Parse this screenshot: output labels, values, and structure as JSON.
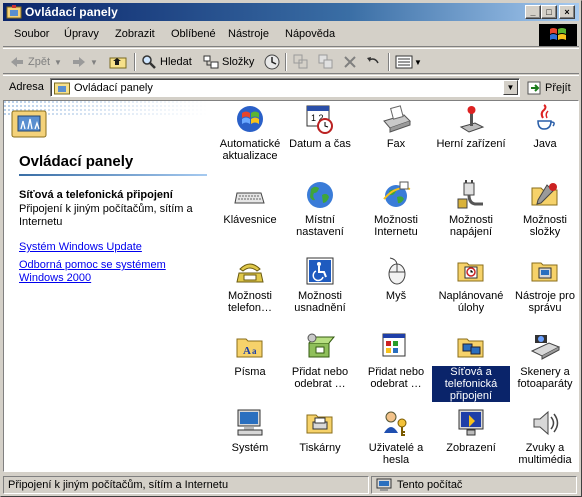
{
  "window": {
    "title": "Ovládací panely"
  },
  "menu": [
    "Soubor",
    "Úpravy",
    "Zobrazit",
    "Oblíbené",
    "Nástroje",
    "Nápověda"
  ],
  "toolbar": {
    "back": "Zpět",
    "search": "Hledat",
    "folders": "Složky"
  },
  "address": {
    "label": "Adresa",
    "value": "Ovládací panely",
    "go": "Přejít"
  },
  "left_pane": {
    "title": "Ovládací panely",
    "selected_name": "Síťová a telefonická připojení",
    "selected_desc": "Připojení k jiným počítačům, sítím a Internetu",
    "links": [
      "Systém Windows Update",
      "Odborná pomoc se systémem Windows 2000"
    ]
  },
  "items": [
    {
      "label": "Automatické aktualizace",
      "icon": "windows-update-icon"
    },
    {
      "label": "Datum a čas",
      "icon": "calendar-clock-icon"
    },
    {
      "label": "Fax",
      "icon": "fax-icon"
    },
    {
      "label": "Herní zařízení",
      "icon": "joystick-icon"
    },
    {
      "label": "Java",
      "icon": "java-cup-icon"
    },
    {
      "label": "Klávesnice",
      "icon": "keyboard-icon"
    },
    {
      "label": "Místní nastavení",
      "icon": "globe-icon"
    },
    {
      "label": "Možnosti Internetu",
      "icon": "internet-globe-icon"
    },
    {
      "label": "Možnosti napájení",
      "icon": "power-plug-icon"
    },
    {
      "label": "Možnosti složky",
      "icon": "folder-options-icon"
    },
    {
      "label": "Možnosti telefon…",
      "icon": "telephone-icon"
    },
    {
      "label": "Možnosti usnadnění",
      "icon": "accessibility-icon"
    },
    {
      "label": "Myš",
      "icon": "mouse-icon"
    },
    {
      "label": "Naplánované úlohy",
      "icon": "scheduled-tasks-icon"
    },
    {
      "label": "Nástroje pro správu",
      "icon": "admin-tools-icon"
    },
    {
      "label": "Písma",
      "icon": "fonts-folder-icon"
    },
    {
      "label": "Přidat nebo odebrat …",
      "icon": "add-remove-programs-icon"
    },
    {
      "label": "Přidat nebo odebrat …",
      "icon": "add-remove-hardware-icon"
    },
    {
      "label": "Síťová a telefonická připojení",
      "icon": "network-connections-icon",
      "selected": true
    },
    {
      "label": "Skenery a fotoaparáty",
      "icon": "scanner-camera-icon"
    },
    {
      "label": "Systém",
      "icon": "computer-icon"
    },
    {
      "label": "Tiskárny",
      "icon": "printers-folder-icon"
    },
    {
      "label": "Uživatelé a hesla",
      "icon": "users-keys-icon"
    },
    {
      "label": "Zobrazení",
      "icon": "display-icon"
    },
    {
      "label": "Zvuky a multimédia",
      "icon": "speaker-icon"
    }
  ],
  "status": {
    "left": "Připojení k jiným počítačům, sítím a Internetu",
    "right": "Tento počítač"
  },
  "colors": {
    "title_active": "#0a246a",
    "face": "#d4d0c8",
    "link": "#0000ee",
    "selection": "#0a246a"
  }
}
